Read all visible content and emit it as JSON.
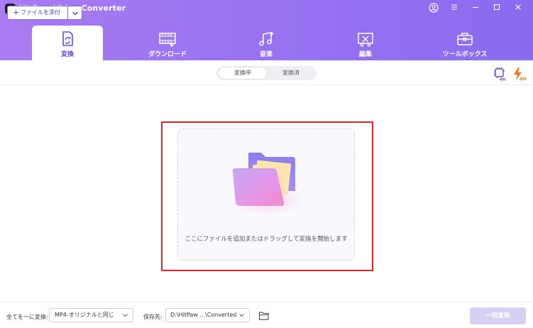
{
  "app": {
    "title": "HitPaw Video Converter"
  },
  "nav": {
    "tabs": [
      {
        "label": "変換",
        "icon": "convert-file-icon",
        "active": true
      },
      {
        "label": "ダウンロード",
        "icon": "film-download-icon",
        "active": false
      },
      {
        "label": "音楽",
        "icon": "music-note-icon",
        "active": false
      },
      {
        "label": "編集",
        "icon": "video-edit-icon",
        "active": false
      },
      {
        "label": "ツールボックス",
        "icon": "toolbox-icon",
        "active": false
      }
    ]
  },
  "toolbar": {
    "add_file_label": "ファイルを添付",
    "segments": {
      "converting": "変換中",
      "converted": "変換済"
    }
  },
  "main": {
    "drop_hint": "ここにファイルを追加またはドラッグして変換を開始します"
  },
  "bottom": {
    "convert_all_label": "全てを一に変換:",
    "format_value": "MP4-オリジナルと同じ",
    "save_label": "保存先:",
    "save_path": "D:\\HitPaw ...\\Converted",
    "convert_all_button": "一括変換"
  },
  "colors": {
    "brand_purple": "#9a73f1",
    "accent": "#6a47e8",
    "highlight_red": "#e02626",
    "fast_orange": "#f07a1a"
  }
}
